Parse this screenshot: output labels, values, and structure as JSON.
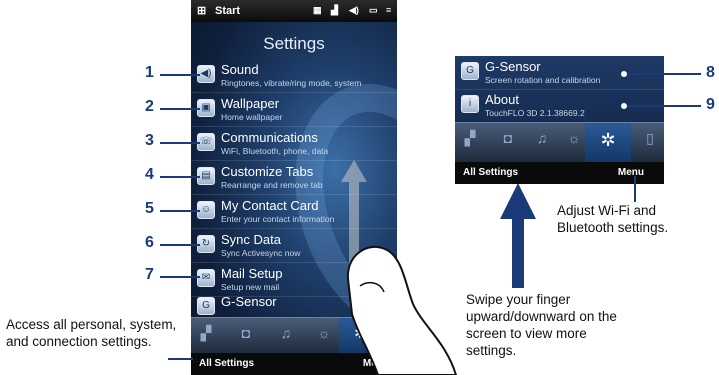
{
  "phone": {
    "status_title": "Start",
    "screen_title": "Settings",
    "items": [
      {
        "title": "Sound",
        "subtitle": "Ringtones, vibrate/ring mode, system",
        "icon": "speaker-icon"
      },
      {
        "title": "Wallpaper",
        "subtitle": "Home wallpaper",
        "icon": "wallpaper-icon"
      },
      {
        "title": "Communications",
        "subtitle": "WiFi, Bluetooth, phone, data",
        "icon": "communications-icon"
      },
      {
        "title": "Customize Tabs",
        "subtitle": "Rearrange and remove tab",
        "icon": "tabs-icon"
      },
      {
        "title": "My Contact Card",
        "subtitle": "Enter your contact information",
        "icon": "contact-card-icon"
      },
      {
        "title": "Sync Data",
        "subtitle": "Sync Activesync now",
        "icon": "sync-icon"
      },
      {
        "title": "Mail Setup",
        "subtitle": "Setup new mail",
        "icon": "mail-icon"
      },
      {
        "title": "G-Sensor",
        "subtitle": "",
        "icon": "g-sensor-icon"
      }
    ],
    "bottom_left": "All Settings",
    "bottom_right": "Menu"
  },
  "inset": {
    "items": [
      {
        "title": "G-Sensor",
        "subtitle": "Screen rotation and calibration"
      },
      {
        "title": "About",
        "subtitle": "TouchFLO 3D 2.1.38669.2"
      }
    ],
    "bottom_left": "All Settings",
    "bottom_right": "Menu"
  },
  "callouts": {
    "numbers": [
      "1",
      "2",
      "3",
      "4",
      "5",
      "6",
      "7",
      "8",
      "9"
    ],
    "access_text": "Access all personal, system, and connection settings.",
    "swipe_text": "Swipe your finger upward/downward on the screen to view more settings.",
    "adjust_text": "Adjust Wi-Fi and Bluetooth settings."
  },
  "colors": {
    "callout": "#1a3a7a",
    "screen_bg": "#0f203d"
  }
}
